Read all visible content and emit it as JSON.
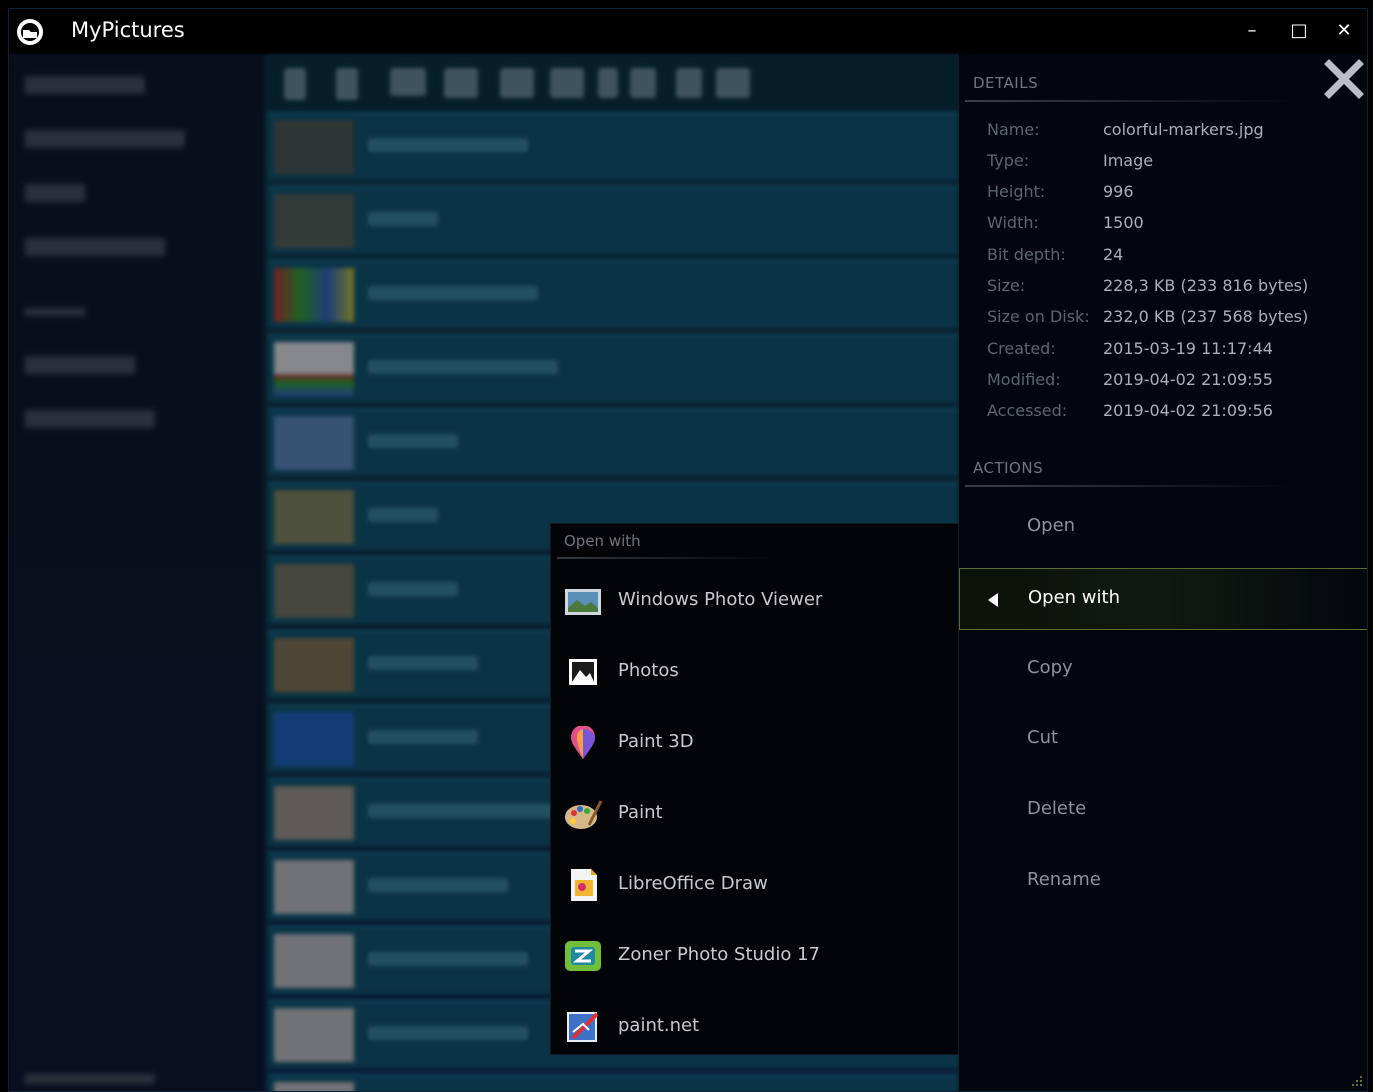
{
  "window": {
    "title": "MyPictures",
    "minimize_label": "–",
    "maximize_label": "□",
    "close_label": "✕"
  },
  "details": {
    "header": "DETAILS",
    "properties": [
      {
        "label": "Name:",
        "value": "colorful-markers.jpg"
      },
      {
        "label": "Type:",
        "value": "Image"
      },
      {
        "label": "Height:",
        "value": "996"
      },
      {
        "label": "Width:",
        "value": "1500"
      },
      {
        "label": "Bit depth:",
        "value": "24"
      },
      {
        "label": "Size:",
        "value": "228,3 KB (233 816 bytes)"
      },
      {
        "label": "Size on Disk:",
        "value": "232,0 KB (237 568 bytes)"
      },
      {
        "label": "Created:",
        "value": "2015-03-19 11:17:44"
      },
      {
        "label": "Modified:",
        "value": "2019-04-02 21:09:55"
      },
      {
        "label": "Accessed:",
        "value": "2019-04-02 21:09:56"
      }
    ]
  },
  "actions": {
    "header": "ACTIONS",
    "items": [
      {
        "label": "Open"
      },
      {
        "label": "Open with"
      },
      {
        "label": "Copy"
      },
      {
        "label": "Cut"
      },
      {
        "label": "Delete"
      },
      {
        "label": "Rename"
      }
    ]
  },
  "open_with": {
    "header": "Open with",
    "apps": [
      {
        "label": "Windows Photo Viewer",
        "icon": "photo-viewer-icon"
      },
      {
        "label": "Photos",
        "icon": "photos-icon"
      },
      {
        "label": "Paint 3D",
        "icon": "paint3d-icon"
      },
      {
        "label": "Paint",
        "icon": "paint-icon"
      },
      {
        "label": "LibreOffice Draw",
        "icon": "libreoffice-draw-icon"
      },
      {
        "label": "Zoner Photo Studio 17",
        "icon": "zoner-icon"
      },
      {
        "label": "paint.net",
        "icon": "paintnet-icon"
      }
    ]
  },
  "colors": {
    "accent_selected_border": "#5b6f2f",
    "panel_bg": "#02070d",
    "list_row": "#0f5670"
  }
}
